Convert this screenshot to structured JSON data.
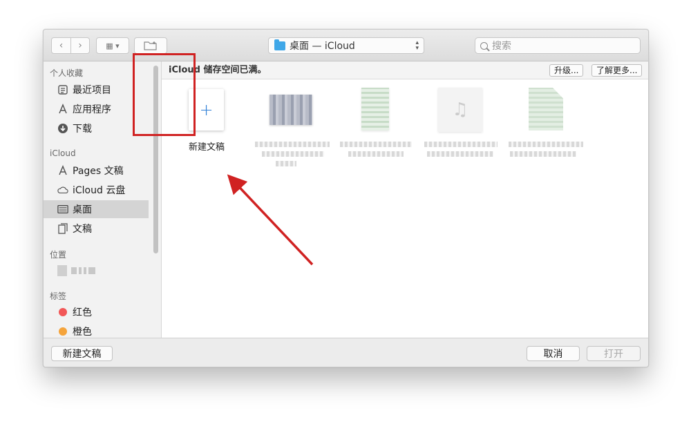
{
  "toolbar": {
    "back_glyph": "‹",
    "forward_glyph": "›",
    "view_glyph": "▦ ▾",
    "path_label": "桌面 — iCloud",
    "search_placeholder": "搜索"
  },
  "sidebar": {
    "favorites_heading": "个人收藏",
    "favorites": [
      {
        "label": "最近项目",
        "icon": "recents-icon"
      },
      {
        "label": "应用程序",
        "icon": "applications-icon"
      },
      {
        "label": "下载",
        "icon": "downloads-icon"
      }
    ],
    "icloud_heading": "iCloud",
    "icloud": [
      {
        "label": "Pages 文稿",
        "icon": "pages-icon"
      },
      {
        "label": "iCloud 云盘",
        "icon": "icloud-drive-icon"
      },
      {
        "label": "桌面",
        "icon": "desktop-icon",
        "selected": true
      },
      {
        "label": "文稿",
        "icon": "documents-icon"
      }
    ],
    "locations_heading": "位置",
    "tags_heading": "标签",
    "tags": [
      {
        "label": "红色",
        "color": "#f25757"
      },
      {
        "label": "橙色",
        "color": "#f5a43b"
      }
    ]
  },
  "infobar": {
    "message": "iCloud 储存空间已满。",
    "upgrade_label": "升级...",
    "learn_more_label": "了解更多..."
  },
  "content": {
    "new_doc_plus": "+",
    "new_doc_label": "新建文稿"
  },
  "footer": {
    "new_doc_button": "新建文稿",
    "cancel_button": "取消",
    "open_button": "打开"
  },
  "colors": {
    "highlight": "#d02222",
    "accent": "#2f7fd6"
  }
}
